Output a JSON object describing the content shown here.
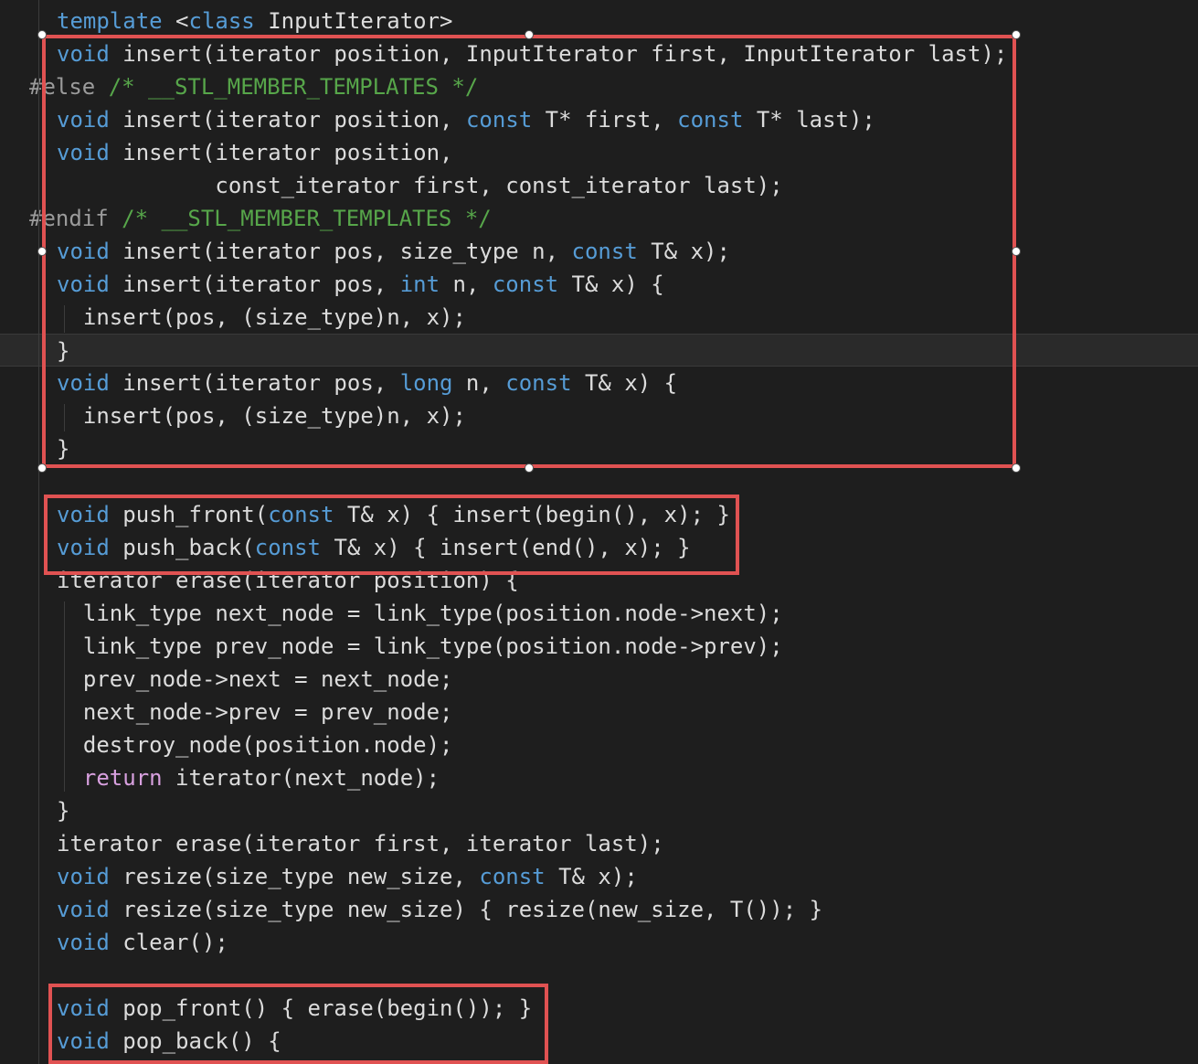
{
  "colors": {
    "background": "#1e1e1e",
    "keyword": "#569cd6",
    "control_keyword": "#d8a0df",
    "comment": "#57a64a",
    "preprocessor": "#9b9b9b",
    "text": "#dcdcdc",
    "highlight_box": "#e05252"
  },
  "code_lines": [
    {
      "tokens": [
        {
          "t": "template",
          "c": "kw"
        },
        {
          "t": " <",
          "c": "pl"
        },
        {
          "t": "class",
          "c": "kw"
        },
        {
          "t": " InputIterator>",
          "c": "pl"
        }
      ]
    },
    {
      "tokens": [
        {
          "t": "void",
          "c": "kw"
        },
        {
          "t": " insert(iterator position, InputIterator first, InputIterator last);",
          "c": "pl"
        }
      ]
    },
    {
      "tokens": [
        {
          "t": "#else",
          "c": "pp"
        },
        {
          "t": " /* __STL_MEMBER_TEMPLATES */",
          "c": "cm"
        }
      ]
    },
    {
      "tokens": [
        {
          "t": "void",
          "c": "kw"
        },
        {
          "t": " insert(iterator position, ",
          "c": "pl"
        },
        {
          "t": "const",
          "c": "kw"
        },
        {
          "t": " T* first, ",
          "c": "pl"
        },
        {
          "t": "const",
          "c": "kw"
        },
        {
          "t": " T* last);",
          "c": "pl"
        }
      ]
    },
    {
      "tokens": [
        {
          "t": "void",
          "c": "kw"
        },
        {
          "t": " insert(iterator position,",
          "c": "pl"
        }
      ]
    },
    {
      "tokens": [
        {
          "t": "            const_iterator first, const_iterator last);",
          "c": "pl"
        }
      ]
    },
    {
      "tokens": [
        {
          "t": "#endif",
          "c": "pp"
        },
        {
          "t": " /* __STL_MEMBER_TEMPLATES */",
          "c": "cm"
        }
      ]
    },
    {
      "tokens": [
        {
          "t": "void",
          "c": "kw"
        },
        {
          "t": " insert(iterator pos, size_type n, ",
          "c": "pl"
        },
        {
          "t": "const",
          "c": "kw"
        },
        {
          "t": " T& x);",
          "c": "pl"
        }
      ]
    },
    {
      "tokens": [
        {
          "t": "void",
          "c": "kw"
        },
        {
          "t": " insert(iterator pos, ",
          "c": "pl"
        },
        {
          "t": "int",
          "c": "kw"
        },
        {
          "t": " n, ",
          "c": "pl"
        },
        {
          "t": "const",
          "c": "kw"
        },
        {
          "t": " T& x) {",
          "c": "pl"
        }
      ]
    },
    {
      "tokens": [
        {
          "t": "  insert(pos, (size_type)n, x);",
          "c": "pl"
        }
      ]
    },
    {
      "tokens": [
        {
          "t": "}",
          "c": "pl"
        }
      ]
    },
    {
      "tokens": [
        {
          "t": "void",
          "c": "kw"
        },
        {
          "t": " insert(iterator pos, ",
          "c": "pl"
        },
        {
          "t": "long",
          "c": "kw"
        },
        {
          "t": " n, ",
          "c": "pl"
        },
        {
          "t": "const",
          "c": "kw"
        },
        {
          "t": " T& x) {",
          "c": "pl"
        }
      ]
    },
    {
      "tokens": [
        {
          "t": "  insert(pos, (size_type)n, x);",
          "c": "pl"
        }
      ]
    },
    {
      "tokens": [
        {
          "t": "}",
          "c": "pl"
        }
      ]
    },
    {
      "tokens": []
    },
    {
      "tokens": [
        {
          "t": "void",
          "c": "kw"
        },
        {
          "t": " push_front(",
          "c": "pl"
        },
        {
          "t": "const",
          "c": "kw"
        },
        {
          "t": " T& x) { insert(begin(), x); }",
          "c": "pl"
        }
      ]
    },
    {
      "tokens": [
        {
          "t": "void",
          "c": "kw"
        },
        {
          "t": " push_back(",
          "c": "pl"
        },
        {
          "t": "const",
          "c": "kw"
        },
        {
          "t": " T& x) { insert(end(), x); }",
          "c": "pl"
        }
      ]
    },
    {
      "tokens": [
        {
          "t": "iterator erase(iterator position) {",
          "c": "pl"
        }
      ]
    },
    {
      "tokens": [
        {
          "t": "  link_type next_node = link_type(position.node->next);",
          "c": "pl"
        }
      ]
    },
    {
      "tokens": [
        {
          "t": "  link_type prev_node = link_type(position.node->prev);",
          "c": "pl"
        }
      ]
    },
    {
      "tokens": [
        {
          "t": "  prev_node->next = next_node;",
          "c": "pl"
        }
      ]
    },
    {
      "tokens": [
        {
          "t": "  next_node->prev = prev_node;",
          "c": "pl"
        }
      ]
    },
    {
      "tokens": [
        {
          "t": "  destroy_node(position.node);",
          "c": "pl"
        }
      ]
    },
    {
      "tokens": [
        {
          "t": "  ",
          "c": "pl"
        },
        {
          "t": "return",
          "c": "ctl"
        },
        {
          "t": " iterator(next_node);",
          "c": "pl"
        }
      ]
    },
    {
      "tokens": [
        {
          "t": "}",
          "c": "pl"
        }
      ]
    },
    {
      "tokens": [
        {
          "t": "iterator erase(iterator first, iterator last);",
          "c": "pl"
        }
      ]
    },
    {
      "tokens": [
        {
          "t": "void",
          "c": "kw"
        },
        {
          "t": " resize(size_type new_size, ",
          "c": "pl"
        },
        {
          "t": "const",
          "c": "kw"
        },
        {
          "t": " T& x);",
          "c": "pl"
        }
      ]
    },
    {
      "tokens": [
        {
          "t": "void",
          "c": "kw"
        },
        {
          "t": " resize(size_type new_size) { resize(new_size, T()); }",
          "c": "pl"
        }
      ]
    },
    {
      "tokens": [
        {
          "t": "void",
          "c": "kw"
        },
        {
          "t": " clear();",
          "c": "pl"
        }
      ]
    },
    {
      "tokens": []
    },
    {
      "tokens": [
        {
          "t": "void",
          "c": "kw"
        },
        {
          "t": " pop_front() { erase(begin()); }",
          "c": "pl"
        }
      ]
    },
    {
      "tokens": [
        {
          "t": "void",
          "c": "kw"
        },
        {
          "t": " pop_back() {",
          "c": "pl"
        }
      ]
    }
  ]
}
